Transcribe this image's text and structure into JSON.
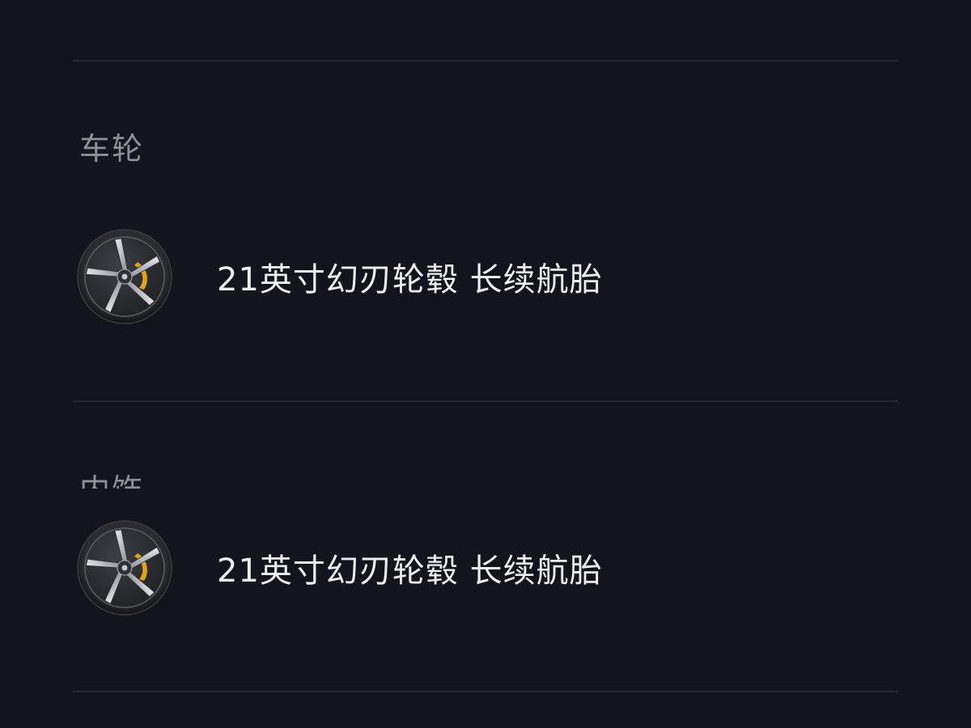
{
  "sections": {
    "wheels": {
      "title": "车轮",
      "option": {
        "label": "21英寸幻刃轮毂 长续航胎",
        "icon": "wheel-icon"
      }
    },
    "interior": {
      "title": "内饰",
      "option": {
        "label": "21英寸幻刃轮毂 长续航胎",
        "icon": "wheel-icon"
      }
    }
  },
  "colors": {
    "background": "#12151b",
    "divider": "#23272e",
    "section_title": "#8d9096",
    "option_text": "#eceef1",
    "caliper": "#e1a319"
  }
}
